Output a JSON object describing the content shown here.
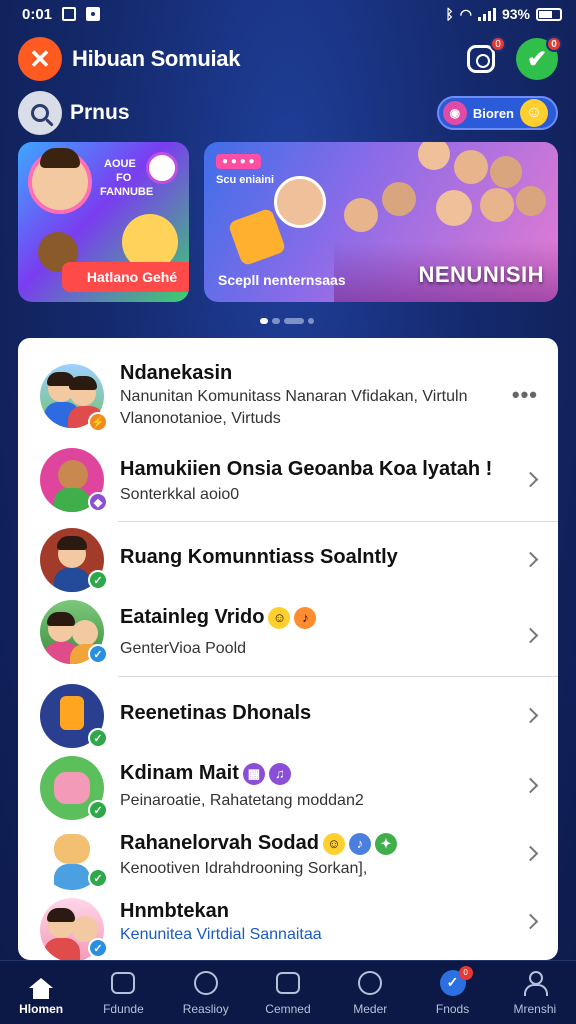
{
  "status_bar": {
    "time": "0:01",
    "battery_percent": "93%"
  },
  "header": {
    "app_title": "Hibuan Somuiak",
    "logo_glyph": "✕",
    "camera_badge": "0",
    "check_badge": "0"
  },
  "search": {
    "label": "Prnus",
    "discover_label": "Bioren"
  },
  "banners": [
    {
      "cta_label": "Hatlano Gehé",
      "top_text_1": "AOUE",
      "top_text_2": "FO",
      "top_text_3": "FANNUBE"
    },
    {
      "tag": "● ● ● ●",
      "subtitle": "Scu eniaini",
      "caption": "Scepll nenternsaas",
      "headline": "NENUNISIH"
    }
  ],
  "carousel": {
    "active_index": 0,
    "count": 3
  },
  "conversations": [
    {
      "title": "Ndanekasin",
      "subtitle": "Nanunitan Komunitass Nanaran Vfidakan, Virtuln",
      "subtitle2": "Vlanonotanioe, Virtuds",
      "status_color": "#f08a1c",
      "action": "more"
    },
    {
      "title": "Hamukiien Onsia Geoanba Koa lyatah !",
      "subtitle": "Sonterkkal aoio0",
      "status_color": "#8a4fd6",
      "action": "chevron"
    },
    {
      "title": "Ruang Komunntiass Soalntly",
      "subtitle": "",
      "status_color": "#2fa84a",
      "action": "chevron"
    },
    {
      "title": "Eatainleg Vrido",
      "subtitle": "GenterVioa Poold",
      "status_color": "#2b8fe0",
      "action": "chevron"
    },
    {
      "title": "Reenetinas Dhonals",
      "subtitle": "",
      "status_color": "#2fa84a",
      "action": "chevron"
    },
    {
      "title": "Kdinam Mait",
      "subtitle": "Peinaroatie, Rahatetang moddan2",
      "status_color": "#2fa84a",
      "action": "chevron"
    },
    {
      "title": "Rahanelorvah Sodad",
      "subtitle": "Kenootiven Idrahdrooning Sorkan],",
      "status_color": "#2fa84a",
      "action": "chevron"
    },
    {
      "title": "Hnmbtekan",
      "subtitle": "Kenunitea Virtdial Sannaitaa",
      "status_color": "#2b8fe0",
      "action": "chevron"
    }
  ],
  "bottom_nav": [
    {
      "label": "Hlomen",
      "icon": "home-icon",
      "active": true
    },
    {
      "label": "Fdunde",
      "icon": "chat-icon",
      "active": false
    },
    {
      "label": "Reaslioy",
      "icon": "explore-icon",
      "active": false
    },
    {
      "label": "Cemned",
      "icon": "list-icon",
      "active": false
    },
    {
      "label": "Meder",
      "icon": "search-icon",
      "active": false
    },
    {
      "label": "Fnods",
      "icon": "check-icon",
      "active": false,
      "badge": "0"
    },
    {
      "label": "Mrenshi",
      "icon": "profile-icon",
      "active": false
    }
  ]
}
